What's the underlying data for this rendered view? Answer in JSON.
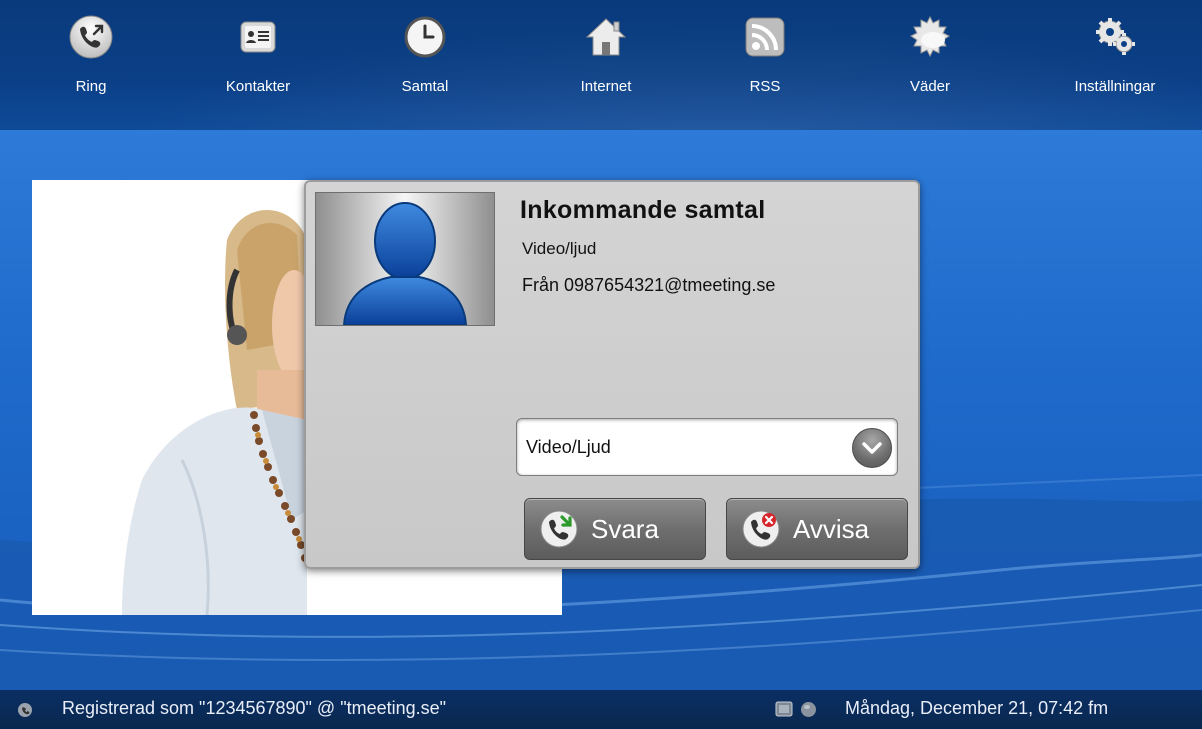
{
  "toolbar": {
    "items": [
      {
        "label": "Ring",
        "icon": "phone-call-icon"
      },
      {
        "label": "Kontakter",
        "icon": "contacts-card-icon"
      },
      {
        "label": "Samtal",
        "icon": "clock-icon"
      },
      {
        "label": "Internet",
        "icon": "home-icon"
      },
      {
        "label": "RSS",
        "icon": "rss-icon"
      },
      {
        "label": "Väder",
        "icon": "weather-cloud-icon"
      },
      {
        "label": "Inställningar",
        "icon": "gears-icon"
      }
    ]
  },
  "dialog": {
    "title": "Inkommande samtal",
    "subtitle": "Video/ljud",
    "from": "Från 0987654321@tmeeting.se",
    "select_value": "Video/Ljud",
    "answer_label": "Svara",
    "reject_label": "Avvisa"
  },
  "status": {
    "registered": "Registrerad som \"1234567890\" @ \"tmeeting.se\"",
    "datetime": "Måndag, December 21, 07:42 fm"
  },
  "colors": {
    "toolbar_bg": "#0b3f86",
    "main_bg": "#1f6bcc",
    "dialog_bg": "#cccccc",
    "statusbar_bg": "#0a2d5c"
  }
}
